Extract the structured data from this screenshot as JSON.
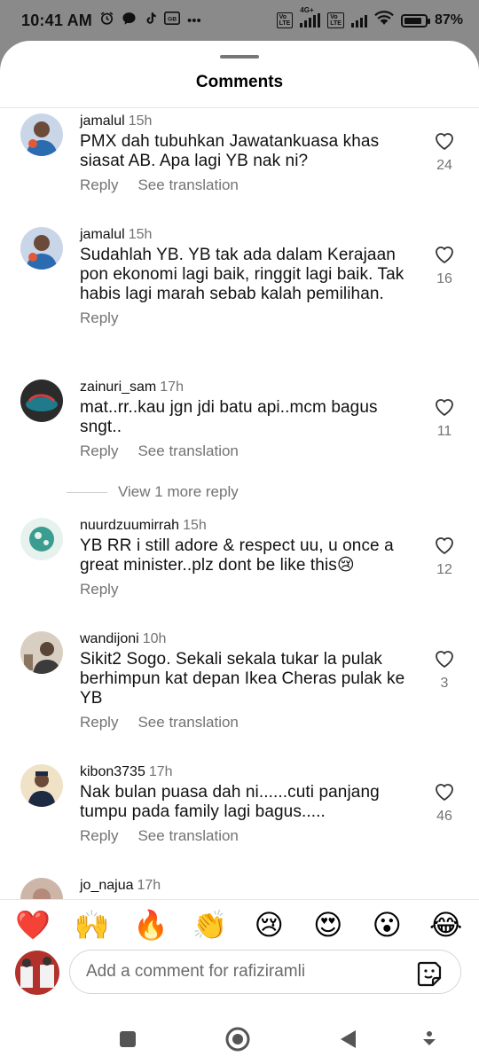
{
  "status_bar": {
    "time": "10:41 AM",
    "battery": "87%",
    "battery_level": 0.87,
    "network": "4G+",
    "icons": [
      "alarm-icon",
      "chat-bubble-icon",
      "tiktok-icon",
      "gb-icon",
      "more-dots-icon",
      "volte-icon",
      "signal-icon",
      "wifi-icon",
      "battery-icon"
    ]
  },
  "sheet": {
    "title": "Comments"
  },
  "comments": [
    {
      "username": "jamalul",
      "time": "15h",
      "text": "PMX dah tubuhkan Jawatankuasa khas siasat AB. Apa lagi YB nak ni?",
      "likes": "24",
      "reply_label": "Reply",
      "translation_label": "See translation",
      "avatar_color": "#2b6cb0"
    },
    {
      "username": "jamalul",
      "time": "15h",
      "text": "Sudahlah YB. YB tak ada dalam Kerajaan pon ekonomi lagi baik, ringgit lagi baik. Tak habis lagi marah sebab kalah pemilihan.",
      "likes": "16",
      "reply_label": "Reply",
      "translation_label": "",
      "avatar_color": "#2b6cb0"
    },
    {
      "username": "zainuri_sam",
      "time": "17h",
      "text": "mat..rr..kau jgn jdi batu api..mcm bagus sngt..",
      "likes": "11",
      "reply_label": "Reply",
      "translation_label": "See translation",
      "avatar_color": "#1f7a8c"
    },
    {
      "username": "nuurdzuumirrah",
      "time": "15h",
      "text": "YB RR i still adore & respect uu, u once a great minister..plz dont be like this😢",
      "likes": "12",
      "reply_label": "Reply",
      "translation_label": "",
      "avatar_color": "#3a9d8f"
    },
    {
      "username": "wandijoni",
      "time": "10h",
      "text": "Sikit2 Sogo. Sekali sekala tukar la pulak berhimpun kat depan Ikea Cheras pulak ke YB",
      "likes": "3",
      "reply_label": "Reply",
      "translation_label": "See translation",
      "avatar_color": "#8a7560"
    },
    {
      "username": "kibon3735",
      "time": "17h",
      "text": "Nak bulan puasa dah ni......cuti panjang tumpu pada family lagi bagus.....",
      "likes": "46",
      "reply_label": "Reply",
      "translation_label": "See translation",
      "avatar_color": "#d9c9a8"
    },
    {
      "username": "jo_najua",
      "time": "17h",
      "text": "",
      "likes": "",
      "reply_label": "",
      "translation_label": "",
      "avatar_color": "#b48a7a"
    }
  ],
  "view_more_replies": "View 1 more reply",
  "quick_emojis": [
    "❤️",
    "🙌",
    "🔥",
    "👏",
    "😢",
    "😍",
    "😮",
    "😂"
  ],
  "compose": {
    "placeholder": "Add a comment for rafiziramli"
  },
  "nav": {
    "icons": [
      "recents-square-icon",
      "home-circle-icon",
      "back-triangle-icon",
      "assistant-icon"
    ]
  },
  "colors": {
    "status_bar_bg": "#8a8a8a",
    "muted_text": "#737373",
    "like_outline": "#333333"
  }
}
